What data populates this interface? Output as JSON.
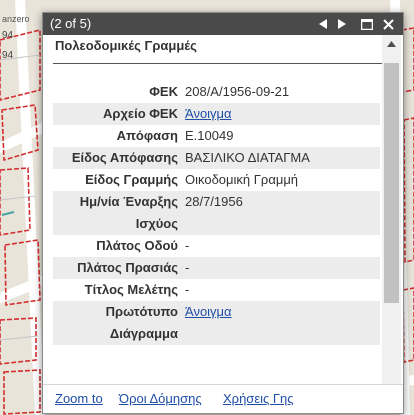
{
  "map": {
    "labels": [
      "94",
      "94",
      "...",
      "anzero"
    ],
    "colors": {
      "parcel_red": "#d32f2f",
      "road": "#ffffff",
      "background": "#e9e4da",
      "teal": "#4aa3a1"
    }
  },
  "popup": {
    "counter": "(2 of 5)",
    "icons": {
      "prev": "triangle-left-icon",
      "next": "triangle-right-icon",
      "maximize": "maximize-icon",
      "close": "close-icon"
    },
    "layer_title": "Πολεοδομικές Γραμμές",
    "attributes": [
      {
        "key": "ΦΕΚ",
        "value": "208/Α/1956-09-21",
        "link": false
      },
      {
        "key": "Αρχείο ΦΕΚ",
        "value": "Άνοιγμα",
        "link": true
      },
      {
        "key": "Απόφαση",
        "value": "Ε.10049",
        "link": false
      },
      {
        "key": "Είδος Απόφασης",
        "value": "ΒΑΣΙΛΙΚΟ ΔΙΑΤΑΓΜΑ",
        "link": false
      },
      {
        "key": "Είδος Γραμμής",
        "value": "Οικοδομική Γραμμή",
        "link": false
      },
      {
        "key": "Ημ/νία Έναρξης Ισχύος",
        "value": "28/7/1956",
        "link": false
      },
      {
        "key": "Πλάτος Οδού",
        "value": "-",
        "link": false
      },
      {
        "key": "Πλάτος Πρασιάς",
        "value": "-",
        "link": false
      },
      {
        "key": "Τίτλος Μελέτης",
        "value": "-",
        "link": false
      },
      {
        "key": "Πρωτότυπο Διάγραμμα",
        "value": "Άνοιγμα",
        "link": true
      }
    ],
    "footer": {
      "zoom": "Zoom to",
      "oroi": "Όροι Δόμησης",
      "xriseis": "Χρήσεις Γης"
    },
    "colors": {
      "titlebar": "#4a4a4a",
      "link": "#1f4ea8",
      "alt_row": "#ececec"
    }
  }
}
